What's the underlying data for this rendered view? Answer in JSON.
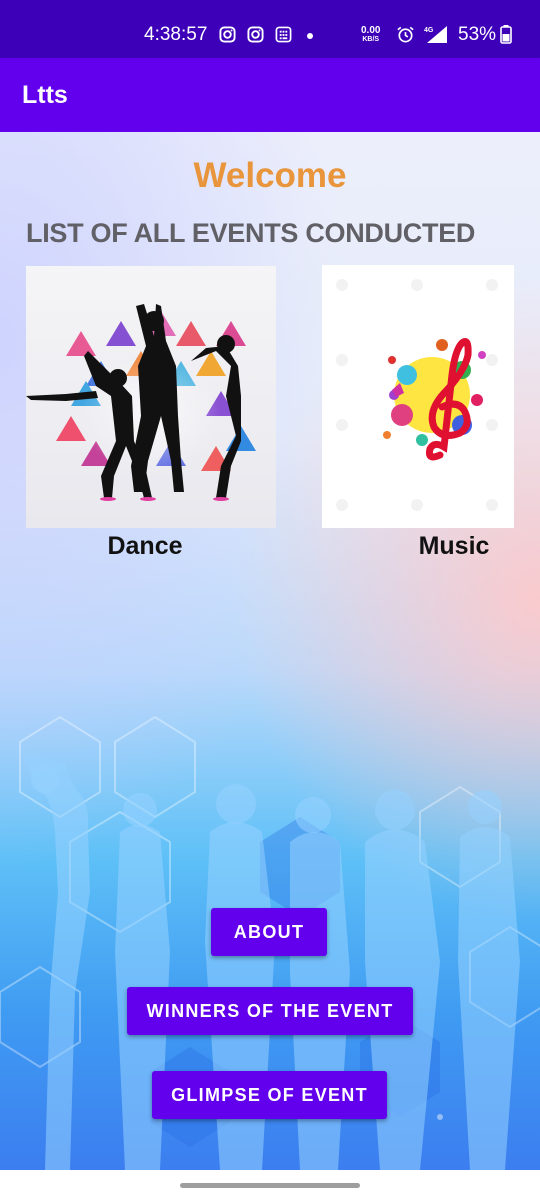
{
  "status_bar": {
    "time": "4:38:57",
    "net_speed_value": "0.00",
    "net_speed_unit": "KB/S",
    "network_type": "4G",
    "battery": "53%"
  },
  "app_bar": {
    "title": "Ltts"
  },
  "main": {
    "welcome": "Welcome",
    "list_heading": "LIST OF ALL EVENTS CONDUCTED",
    "events": [
      {
        "label": "Dance"
      },
      {
        "label": "Music"
      }
    ]
  },
  "buttons": {
    "about": "ABOUT",
    "winners": "WINNERS OF THE EVENT",
    "glimpse": "GLIMPSE OF EVENT"
  },
  "colors": {
    "status_bar": "#3d00b8",
    "app_bar": "#6200ee",
    "accent_welcome": "#e8953b",
    "button": "#6200ee"
  }
}
